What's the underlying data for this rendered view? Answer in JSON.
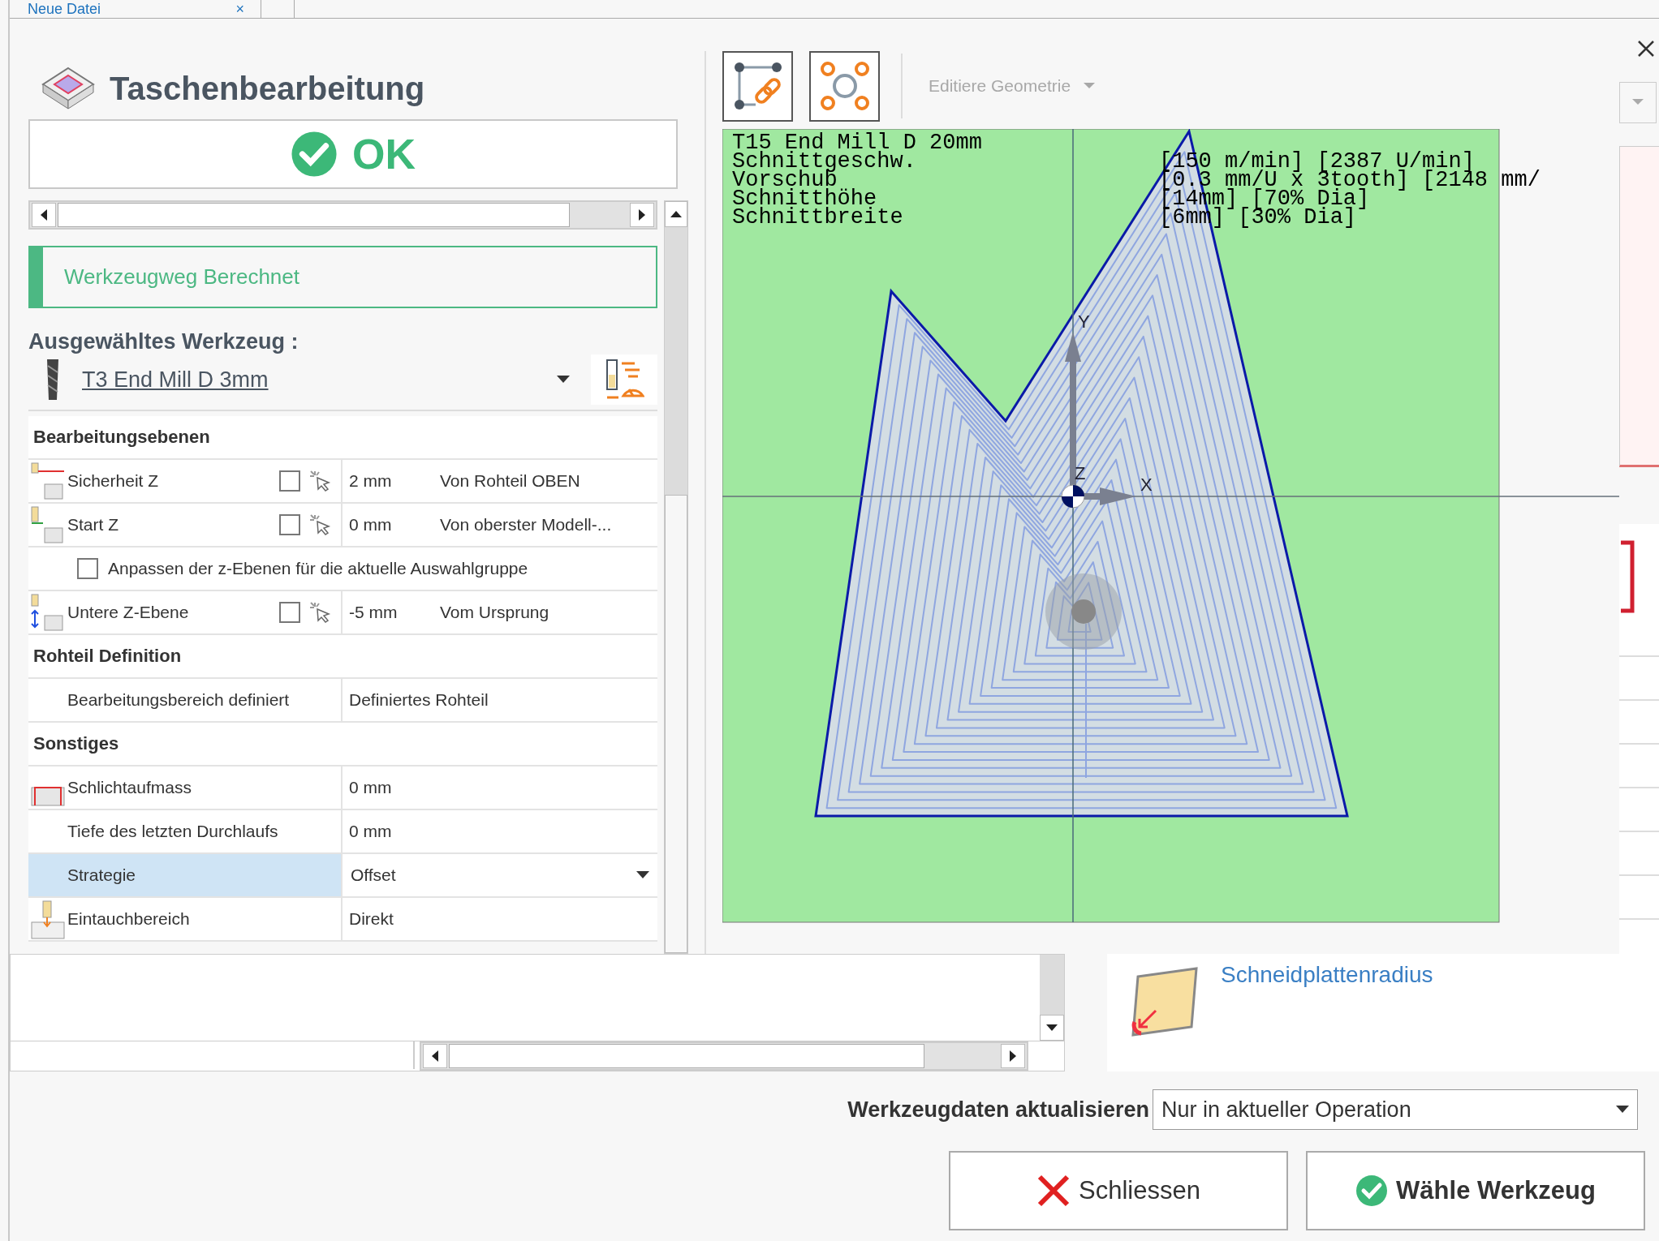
{
  "tabs": [
    {
      "label": "Neue Datei",
      "close": "×",
      "selected": true
    }
  ],
  "header": {
    "title": "Taschenbearbeitung",
    "ok": "OK"
  },
  "status": {
    "text": "Werkzeugweg Berechnet"
  },
  "tool": {
    "label": "Ausgewähltes Werkzeug :",
    "name": "T3 End Mill D 3mm"
  },
  "properties": [
    {
      "kind": "section",
      "label": "Bearbeitungsebenen"
    },
    {
      "kind": "level",
      "label": "Sicherheit Z",
      "checked": false,
      "value": "2 mm",
      "reference": "Von Rohteil OBEN"
    },
    {
      "kind": "level",
      "label": "Start Z",
      "checked": false,
      "value": "0 mm",
      "reference": "Von oberster Modell-..."
    },
    {
      "kind": "option",
      "label": "Anpassen der z-Ebenen für die aktuelle Auswahlgruppe",
      "checked": false
    },
    {
      "kind": "level",
      "label": "Untere Z-Ebene",
      "checked": false,
      "value": "-5 mm",
      "reference": "Vom Ursprung"
    },
    {
      "kind": "section",
      "label": "Rohteil Definition"
    },
    {
      "kind": "field",
      "label": "Bearbeitungsbereich definiert",
      "value": "Definiertes Rohteil",
      "selected": false
    },
    {
      "kind": "section",
      "label": "Sonstiges"
    },
    {
      "kind": "field",
      "label": "Schlichtaufmass",
      "value": "0 mm",
      "selected": false
    },
    {
      "kind": "field",
      "label": "Tiefe des letzten Durchlaufs",
      "value": "0 mm",
      "selected": false
    },
    {
      "kind": "dropdown",
      "label": "Strategie",
      "value": "Offset",
      "selected": true
    },
    {
      "kind": "field",
      "label": "Eintauchbereich",
      "value": "Direkt",
      "selected": false
    }
  ],
  "toolbar": {
    "menu": "Editiere Geometrie",
    "disabled": true
  },
  "viewport": {
    "info": [
      {
        "label": "T15 End Mill D 20mm"
      },
      {
        "label": "Schnittgeschw.",
        "value": "[150 m/min] [2387 U/min]"
      },
      {
        "label": "Vorschub",
        "value": "[0.3 mm/U x 3tooth] [2148 mm/"
      },
      {
        "label": "Schnitthöhe",
        "value": "[14mm] [70% Dia]"
      },
      {
        "label": "Schnittbreite",
        "value": "[6mm] [30% Dia]"
      }
    ],
    "axes": {
      "y": "Y",
      "z": "Z",
      "x": "X"
    }
  },
  "insert": {
    "label": "Schneidplattenradius"
  },
  "update": {
    "label": "Werkzeugdaten aktualisieren",
    "value": "Nur in aktueller Operation"
  },
  "buttons": [
    {
      "kind": "close",
      "label": "Schliessen"
    },
    {
      "kind": "confirm",
      "label": "Wähle Werkzeug"
    }
  ]
}
